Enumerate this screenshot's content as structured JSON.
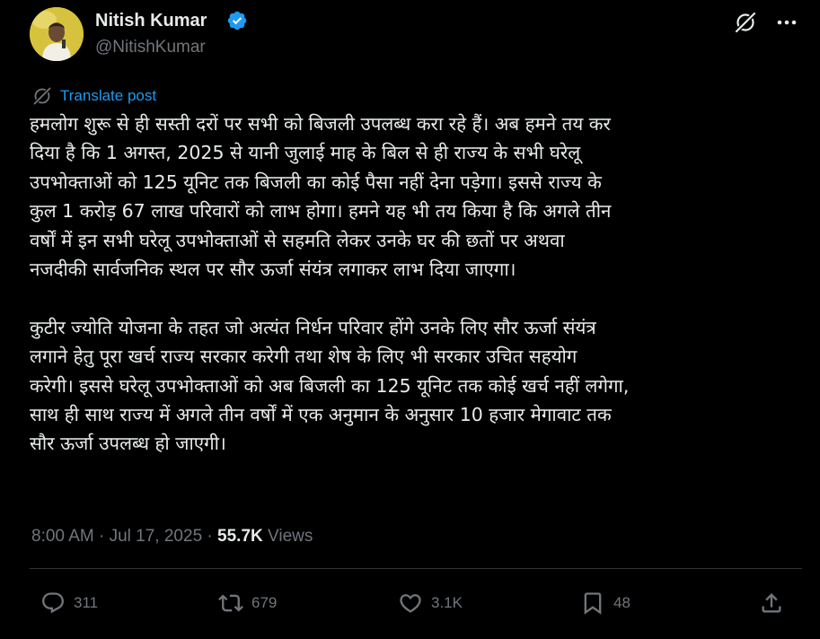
{
  "author": {
    "display_name": "Nitish Kumar",
    "handle": "@NitishKumar",
    "verified": true
  },
  "translate_label": "Translate post",
  "post": {
    "paragraphs": [
      "हमलोग शुरू से ही सस्ती दरों पर सभी को बिजली उपलब्ध करा रहे हैं। अब हमने तय कर\nदिया है कि 1 अगस्त, 2025 से यानी जुलाई माह के बिल से ही राज्य के सभी घरेलू\nउपभोक्ताओं को 125 यूनिट तक बिजली का कोई पैसा नहीं देना पड़ेगा। इससे राज्य के\nकुल 1 करोड़ 67 लाख परिवारों को लाभ होगा। हमने यह भी तय किया है कि अगले तीन\nवर्षों में इन सभी घरेलू उपभोक्ताओं से सहमति लेकर उनके घर की छतों पर अथवा\nनजदीकी सार्वजनिक स्थल पर सौर ऊर्जा संयंत्र लगाकर लाभ दिया जाएगा।",
      "कुटीर ज्योति योजना के तहत जो अत्यंत निर्धन परिवार होंगे उनके लिए सौर ऊर्जा संयंत्र\nलगाने हेतु पूरा खर्च राज्य सरकार करेगी तथा शेष के लिए भी सरकार उचित सहयोग\nकरेगी। इससे घरेलू उपभोक्ताओं को अब बिजली का 125 यूनिट तक कोई खर्च नहीं लगेगा,\nसाथ ही साथ राज्य में अगले तीन वर्षों में एक अनुमान के अनुसार 10 हजार मेगावाट तक\nसौर ऊर्जा उपलब्ध हो जाएगी।"
    ]
  },
  "meta": {
    "time": "8:00 AM",
    "separator": " · ",
    "date": "Jul 17, 2025",
    "views_count": "55.7K",
    "views_label": " Views"
  },
  "actions": {
    "replies": "311",
    "reposts": "679",
    "likes": "3.1K",
    "bookmarks": "48"
  },
  "icons": {
    "grok": "grok-icon",
    "more": "more-icon",
    "translate": "translate-icon",
    "reply": "reply-icon",
    "repost": "repost-icon",
    "like": "like-icon",
    "bookmark": "bookmark-icon",
    "share": "share-icon"
  },
  "colors": {
    "background": "#000000",
    "text": "#e7e9ea",
    "muted": "#71767b",
    "link": "#1d9bf0",
    "verified": "#1d9bf0",
    "divider": "#2f3336"
  }
}
